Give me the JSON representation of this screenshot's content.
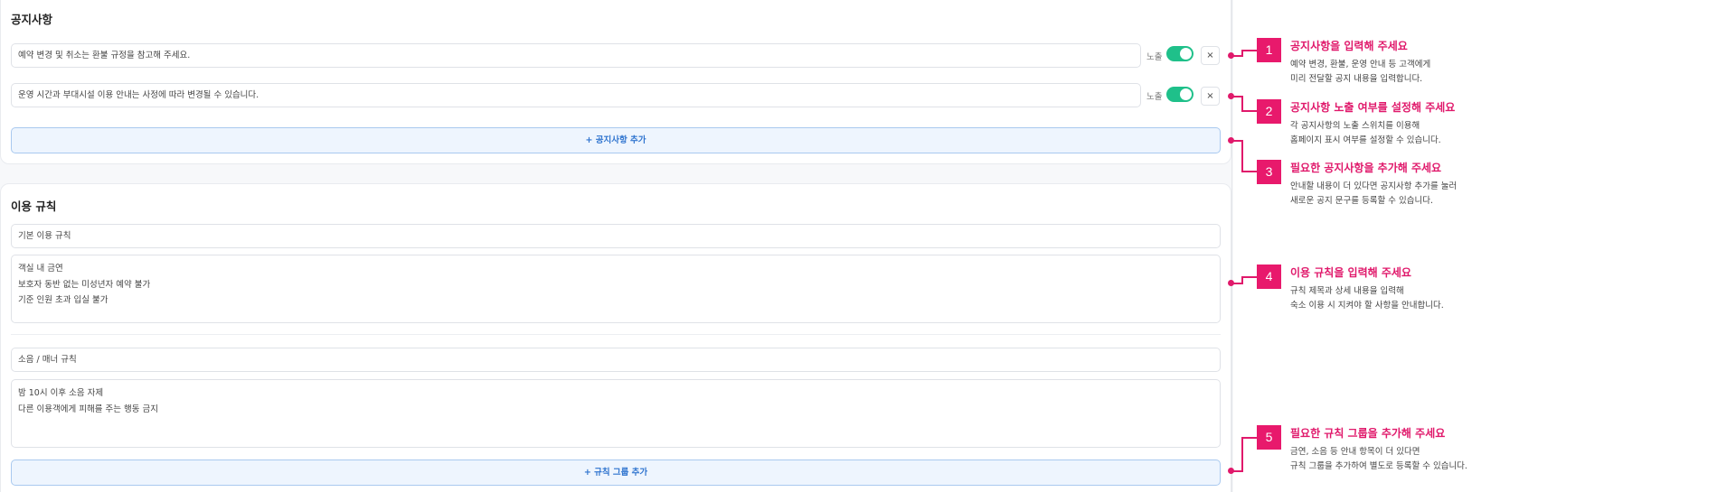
{
  "notice": {
    "title": "공지사항",
    "items": [
      {
        "text": "예약 변경 및 취소는 환불 규정을 참고해 주세요.",
        "toggle_label": "노출",
        "delete_label": "×"
      },
      {
        "text": "운영 시간과 부대시설 이용 안내는 사정에 따라 변경될 수 있습니다.",
        "toggle_label": "노출",
        "delete_label": "×"
      }
    ],
    "add_label": "+ 공지사항 추가"
  },
  "rules": {
    "title": "이용 규칙",
    "groups": [
      {
        "title": "기본 이용 규칙",
        "lines": [
          "객실 내 금연",
          "보호자 동반 없는 미성년자 예약 불가",
          "기준 인원 초과 입실 불가"
        ]
      },
      {
        "title": "소음 / 매너 규칙",
        "lines": [
          "밤 10시 이후 소음 자제",
          "다른 이용객에게 피해를 주는 행동 금지"
        ]
      }
    ],
    "add_label": "+ 규칙 그룹 추가"
  },
  "annotations": [
    {
      "number": "1",
      "title": "공지사항을 입력해 주세요",
      "desc": [
        "예약 변경, 환불, 운영 안내 등 고객에게",
        "미리 전달할 공지 내용을 입력합니다."
      ]
    },
    {
      "number": "2",
      "title": "공지사항 노출 여부를 설정해 주세요",
      "desc": [
        "각 공지사항의 노출 스위치를 이용해",
        "홈페이지 표시 여부를 설정할 수 있습니다."
      ]
    },
    {
      "number": "3",
      "title": "필요한 공지사항을 추가해 주세요",
      "desc": [
        "안내할 내용이 더 있다면 공지사항 추가를 눌러",
        "새로운 공지 문구를 등록할 수 있습니다."
      ]
    },
    {
      "number": "4",
      "title": "이용 규칙을 입력해 주세요",
      "desc": [
        "규칙 제목과 상세 내용을 입력해",
        "숙소 이용 시 지켜야 할 사항을 안내합니다."
      ]
    },
    {
      "number": "5",
      "title": "필요한 규칙 그룹을 추가해 주세요",
      "desc": [
        "금연, 소음 등 안내 항목이 더 있다면",
        "규칙 그룹을 추가하여 별도로 등록할 수 있습니다."
      ]
    }
  ],
  "colors": {
    "accent": "#e8196c",
    "toggle_on": "#1fc08a",
    "add_button_text": "#2f74cf"
  }
}
